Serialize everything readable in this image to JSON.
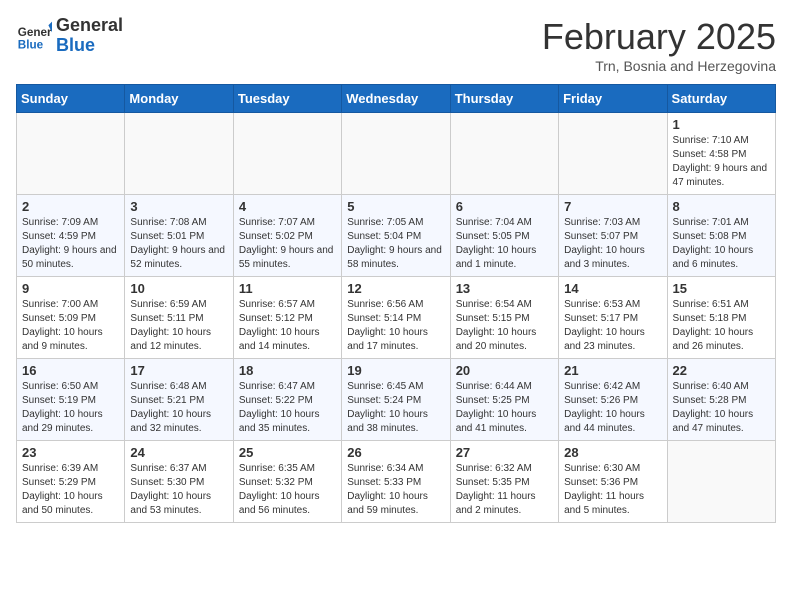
{
  "header": {
    "logo_general": "General",
    "logo_blue": "Blue",
    "title": "February 2025",
    "subtitle": "Trn, Bosnia and Herzegovina"
  },
  "weekdays": [
    "Sunday",
    "Monday",
    "Tuesday",
    "Wednesday",
    "Thursday",
    "Friday",
    "Saturday"
  ],
  "weeks": [
    [
      {
        "day": "",
        "info": ""
      },
      {
        "day": "",
        "info": ""
      },
      {
        "day": "",
        "info": ""
      },
      {
        "day": "",
        "info": ""
      },
      {
        "day": "",
        "info": ""
      },
      {
        "day": "",
        "info": ""
      },
      {
        "day": "1",
        "info": "Sunrise: 7:10 AM\nSunset: 4:58 PM\nDaylight: 9 hours and 47 minutes."
      }
    ],
    [
      {
        "day": "2",
        "info": "Sunrise: 7:09 AM\nSunset: 4:59 PM\nDaylight: 9 hours and 50 minutes."
      },
      {
        "day": "3",
        "info": "Sunrise: 7:08 AM\nSunset: 5:01 PM\nDaylight: 9 hours and 52 minutes."
      },
      {
        "day": "4",
        "info": "Sunrise: 7:07 AM\nSunset: 5:02 PM\nDaylight: 9 hours and 55 minutes."
      },
      {
        "day": "5",
        "info": "Sunrise: 7:05 AM\nSunset: 5:04 PM\nDaylight: 9 hours and 58 minutes."
      },
      {
        "day": "6",
        "info": "Sunrise: 7:04 AM\nSunset: 5:05 PM\nDaylight: 10 hours and 1 minute."
      },
      {
        "day": "7",
        "info": "Sunrise: 7:03 AM\nSunset: 5:07 PM\nDaylight: 10 hours and 3 minutes."
      },
      {
        "day": "8",
        "info": "Sunrise: 7:01 AM\nSunset: 5:08 PM\nDaylight: 10 hours and 6 minutes."
      }
    ],
    [
      {
        "day": "9",
        "info": "Sunrise: 7:00 AM\nSunset: 5:09 PM\nDaylight: 10 hours and 9 minutes."
      },
      {
        "day": "10",
        "info": "Sunrise: 6:59 AM\nSunset: 5:11 PM\nDaylight: 10 hours and 12 minutes."
      },
      {
        "day": "11",
        "info": "Sunrise: 6:57 AM\nSunset: 5:12 PM\nDaylight: 10 hours and 14 minutes."
      },
      {
        "day": "12",
        "info": "Sunrise: 6:56 AM\nSunset: 5:14 PM\nDaylight: 10 hours and 17 minutes."
      },
      {
        "day": "13",
        "info": "Sunrise: 6:54 AM\nSunset: 5:15 PM\nDaylight: 10 hours and 20 minutes."
      },
      {
        "day": "14",
        "info": "Sunrise: 6:53 AM\nSunset: 5:17 PM\nDaylight: 10 hours and 23 minutes."
      },
      {
        "day": "15",
        "info": "Sunrise: 6:51 AM\nSunset: 5:18 PM\nDaylight: 10 hours and 26 minutes."
      }
    ],
    [
      {
        "day": "16",
        "info": "Sunrise: 6:50 AM\nSunset: 5:19 PM\nDaylight: 10 hours and 29 minutes."
      },
      {
        "day": "17",
        "info": "Sunrise: 6:48 AM\nSunset: 5:21 PM\nDaylight: 10 hours and 32 minutes."
      },
      {
        "day": "18",
        "info": "Sunrise: 6:47 AM\nSunset: 5:22 PM\nDaylight: 10 hours and 35 minutes."
      },
      {
        "day": "19",
        "info": "Sunrise: 6:45 AM\nSunset: 5:24 PM\nDaylight: 10 hours and 38 minutes."
      },
      {
        "day": "20",
        "info": "Sunrise: 6:44 AM\nSunset: 5:25 PM\nDaylight: 10 hours and 41 minutes."
      },
      {
        "day": "21",
        "info": "Sunrise: 6:42 AM\nSunset: 5:26 PM\nDaylight: 10 hours and 44 minutes."
      },
      {
        "day": "22",
        "info": "Sunrise: 6:40 AM\nSunset: 5:28 PM\nDaylight: 10 hours and 47 minutes."
      }
    ],
    [
      {
        "day": "23",
        "info": "Sunrise: 6:39 AM\nSunset: 5:29 PM\nDaylight: 10 hours and 50 minutes."
      },
      {
        "day": "24",
        "info": "Sunrise: 6:37 AM\nSunset: 5:30 PM\nDaylight: 10 hours and 53 minutes."
      },
      {
        "day": "25",
        "info": "Sunrise: 6:35 AM\nSunset: 5:32 PM\nDaylight: 10 hours and 56 minutes."
      },
      {
        "day": "26",
        "info": "Sunrise: 6:34 AM\nSunset: 5:33 PM\nDaylight: 10 hours and 59 minutes."
      },
      {
        "day": "27",
        "info": "Sunrise: 6:32 AM\nSunset: 5:35 PM\nDaylight: 11 hours and 2 minutes."
      },
      {
        "day": "28",
        "info": "Sunrise: 6:30 AM\nSunset: 5:36 PM\nDaylight: 11 hours and 5 minutes."
      },
      {
        "day": "",
        "info": ""
      }
    ]
  ]
}
